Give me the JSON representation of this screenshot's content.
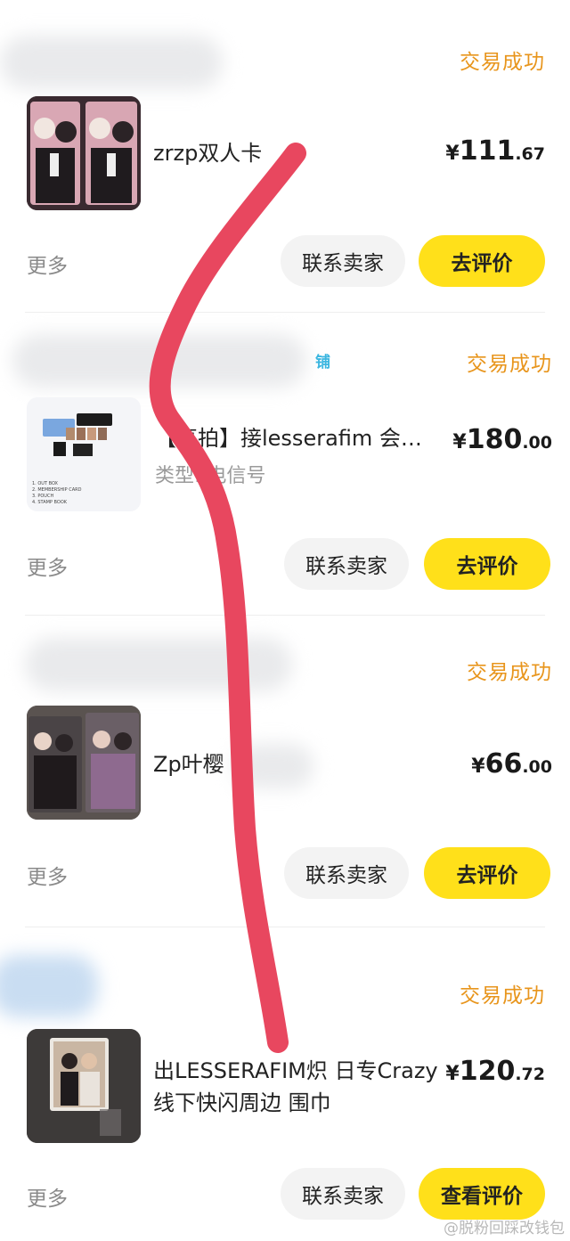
{
  "orders": [
    {
      "status": "交易成功",
      "title": "zrzp双人卡",
      "subtitle": "",
      "price_currency": "¥",
      "price_int": "111",
      "price_dec": ".67",
      "more": "更多",
      "contact_label": "联系卖家",
      "action_label": "去评价"
    },
    {
      "shop_tag": "铺",
      "status": "交易成功",
      "title": "【直拍】接lesserafim 会…",
      "subtitle": "类型: 电信号",
      "price_currency": "¥",
      "price_int": "180",
      "price_dec": ".00",
      "more": "更多",
      "contact_label": "联系卖家",
      "action_label": "去评价",
      "thumb_lines": [
        "1. OUT BOX",
        "2. MEMBERSHIP CARD",
        "3. POUCH",
        "4. STAMP BOOK"
      ]
    },
    {
      "status": "交易成功",
      "title": "Zp叶樱",
      "subtitle": "",
      "price_currency": "¥",
      "price_int": "66",
      "price_dec": ".00",
      "more": "更多",
      "contact_label": "联系卖家",
      "action_label": "去评价"
    },
    {
      "status": "交易成功",
      "title": "出LESSERAFIM炽 日专Crazy",
      "title2": "线下快闪周边 围巾",
      "subtitle": "",
      "price_currency": "¥",
      "price_int": "120",
      "price_dec": ".72",
      "more": "更多",
      "contact_label": "联系卖家",
      "action_label": "查看评价"
    }
  ],
  "watermark": "@脱粉回踩改钱包",
  "colors": {
    "status": "#e8951c",
    "action_button": "#ffe01a",
    "contact_button": "#f3f3f3",
    "annotation_stroke": "#e8475f"
  }
}
